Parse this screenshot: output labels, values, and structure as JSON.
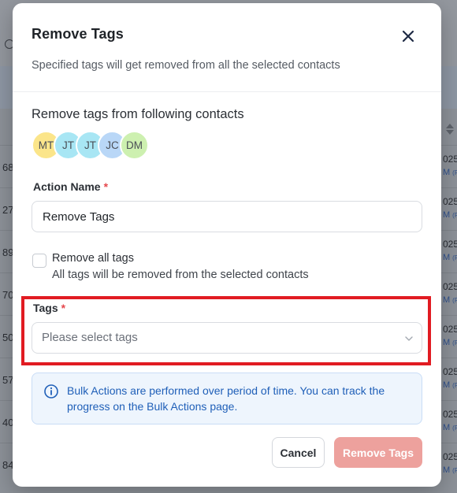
{
  "background": {
    "left_values": [
      "68",
      "27",
      "89",
      "70",
      "50",
      "57",
      "40",
      "84"
    ],
    "right_year_fragment": "025",
    "right_time_fragment": "M",
    "right_extra_fragment": "(F"
  },
  "modal": {
    "title": "Remove Tags",
    "subtitle": "Specified tags will get removed from all the selected contacts",
    "contacts_section_title": "Remove tags from following contacts",
    "avatars": [
      {
        "initials": "MT",
        "color": "#fbe58a"
      },
      {
        "initials": "JT",
        "color": "#a8e6f4"
      },
      {
        "initials": "JT",
        "color": "#a8e6f4"
      },
      {
        "initials": "JC",
        "color": "#b9d7f7"
      },
      {
        "initials": "DM",
        "color": "#cdf0b0"
      }
    ],
    "action_name": {
      "label": "Action Name",
      "required_mark": "*",
      "value": "Remove Tags"
    },
    "remove_all": {
      "label": "Remove all tags",
      "help": "All tags will be removed from the selected contacts",
      "checked": false
    },
    "tags": {
      "label": "Tags",
      "required_mark": "*",
      "placeholder": "Please select tags"
    },
    "info": {
      "text": "Bulk Actions are performed over period of time. You can track the progress on the Bulk Actions page."
    },
    "buttons": {
      "cancel": "Cancel",
      "submit": "Remove Tags"
    },
    "colors": {
      "accent_red": "#e11b22",
      "info_blue": "#1f5fb8",
      "submit_disabled": "#eda19d"
    }
  }
}
